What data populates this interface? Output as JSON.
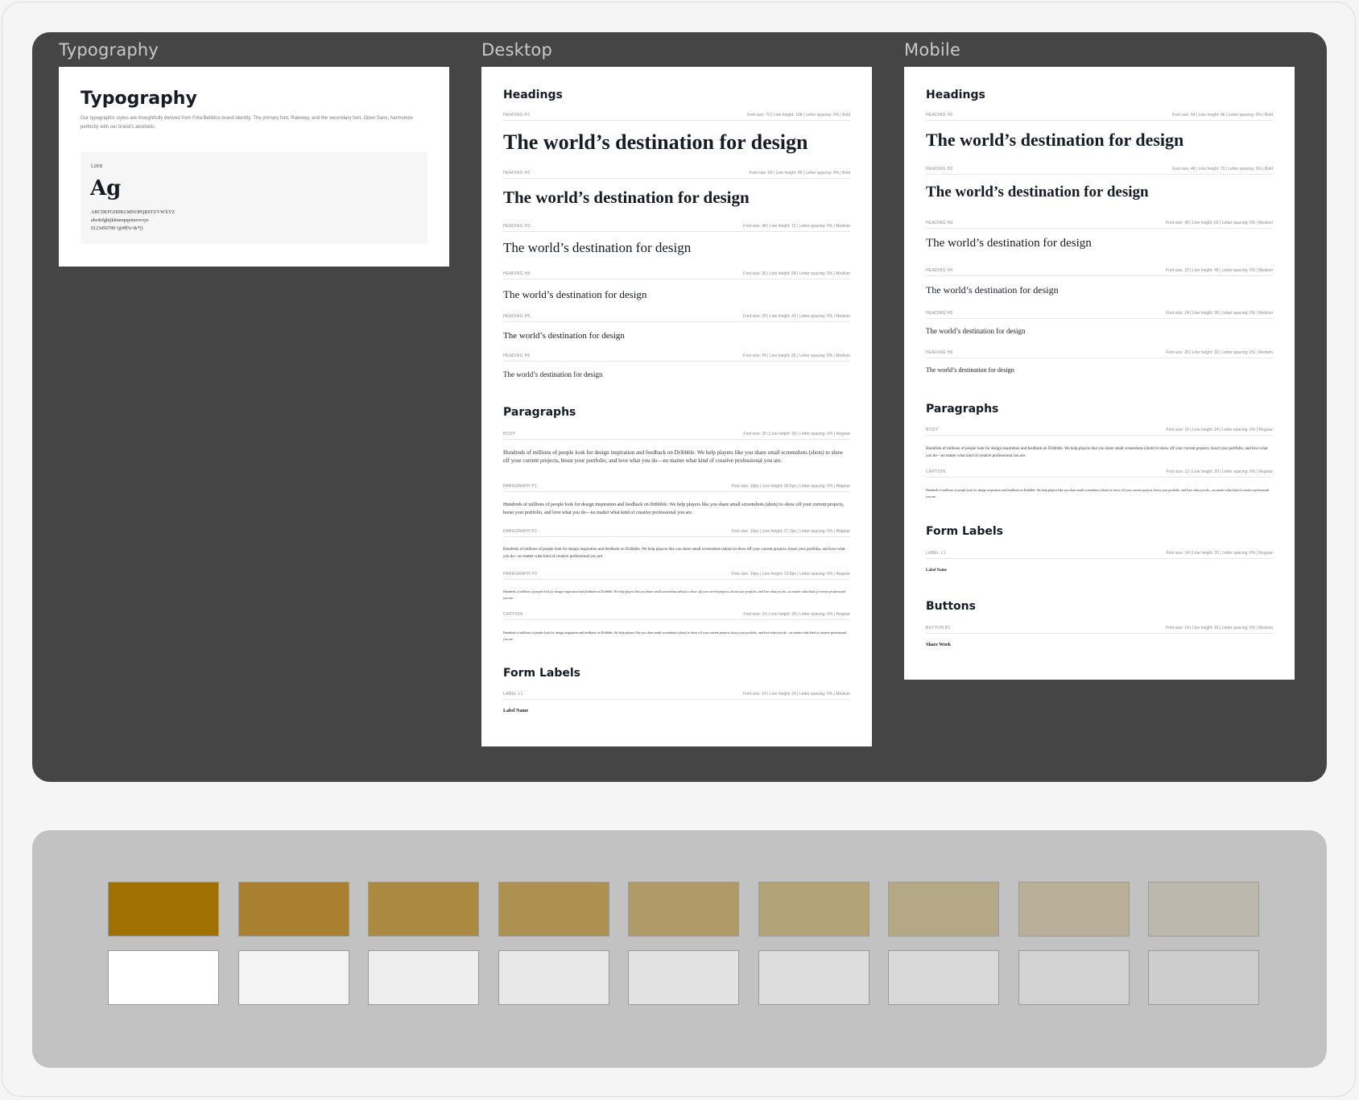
{
  "frames": {
    "typography_label": "Typography",
    "desktop_label": "Desktop",
    "mobile_label": "Mobile"
  },
  "typography_card": {
    "title": "Typography",
    "description": "Our typographic styles are thoughtfully derived from Frita Bellidos brand identity. The primary font, Raleway, and the secondary font, Open Sans, harmonize perfectly with our brand's aesthetic.",
    "font_name": "Lora",
    "specimen": "Ag",
    "uppercase": "ABCDEFGHIJKLMNOPQRSTUVWXYZ",
    "lowercase": "abcdefghijklmnopqrstuvwxyz",
    "numerals": "0123456789 !@#$%^&*()"
  },
  "sample_text": "The world’s destination for design",
  "paragraph_text": "Hundreds of millions of people look for design inspiration and feedback on Dribbble. We help players like you share small screenshots (shots) to show off your current projects, boost your portfolio, and love what you do—no matter what kind of creative professional you are.",
  "label_sample": "Label Name",
  "button_sample": "Share Work",
  "sections": {
    "headings": "Headings",
    "paragraphs": "Paragraphs",
    "form_labels": "Form Labels",
    "buttons": "Buttons"
  },
  "desktop": {
    "headings": [
      {
        "name": "HEADING H1",
        "meta": "Font size: 72 | Line height: 108 | Letter spacing: 0% | Bold"
      },
      {
        "name": "HEADING H2",
        "meta": "Font size: 60 | Line height: 90 | Letter spacing: 0% | Bold"
      },
      {
        "name": "HEADING H3",
        "meta": "Font size: 48 | Line height: 72 | Letter spacing: 0% | Medium"
      },
      {
        "name": "HEADING H4",
        "meta": "Font size: 36 | Line height: 54 | Letter spacing: 0% | Medium"
      },
      {
        "name": "HEADING H5",
        "meta": "Font size: 28 | Line height: 42 | Letter spacing: 0% | Medium"
      },
      {
        "name": "HEADING H6",
        "meta": "Font size: 24 | Line height: 36 | Letter spacing: 0% | Medium"
      }
    ],
    "paragraphs": [
      {
        "name": "BODY",
        "meta": "Font size: 20 | Line height: 30 | Letter spacing: 0% | Regular"
      },
      {
        "name": "PARAGRAPH P1",
        "meta": "Font size: 18px | Line height: 30.6px | Letter spacing: 0% | Regular"
      },
      {
        "name": "PARAGRAPH P2",
        "meta": "Font size: 16px | Line height: 27.2px | Letter spacing: 0% | Regular"
      },
      {
        "name": "PARAGRAPH P3",
        "meta": "Font size: 14px | Line height: 23.8px | Letter spacing: 0% | Regular"
      },
      {
        "name": "CAPTION",
        "meta": "Font size: 14 | Line height: 25 | Letter spacing: 0% | Regular"
      }
    ],
    "form_labels": [
      {
        "name": "LABEL L1",
        "meta": "Font size: 14 | Line height: 20 | Letter spacing: 0% | Medium"
      }
    ]
  },
  "mobile": {
    "headings": [
      {
        "name": "HEADING H1",
        "meta": "Font size: 64 | Line height: 96 | Letter spacing: 0% | Bold"
      },
      {
        "name": "HEADING H2",
        "meta": "Font size: 48 | Line height: 72 | Letter spacing: 0% | Bold"
      },
      {
        "name": "HEADING H3",
        "meta": "Font size: 40 | Line height: 60 | Letter spacing: 0% | Medium"
      },
      {
        "name": "HEADING H4",
        "meta": "Font size: 32 | Line height: 48 | Letter spacing: 0% | Medium"
      },
      {
        "name": "HEADING H5",
        "meta": "Font size: 24 | Line height: 36 | Letter spacing: 0% | Medium"
      },
      {
        "name": "HEADING H6",
        "meta": "Font size: 20 | Line height: 32 | Letter spacing: 0% | Medium"
      }
    ],
    "paragraphs": [
      {
        "name": "BODY",
        "meta": "Font size: 16 | Line height: 24 | Letter spacing: 0% | Regular"
      },
      {
        "name": "CAPTION",
        "meta": "Font size: 12 | Line height: 20 | Letter spacing: 0% | Regular"
      }
    ],
    "form_labels": [
      {
        "name": "LABEL L1",
        "meta": "Font size: 14 | Line height: 20 | Letter spacing: 0% | Regular"
      }
    ],
    "buttons": [
      {
        "name": "BUTTON B1",
        "meta": "Font size: 14 | Line height: 16 | Letter spacing: 0% | Medium"
      }
    ]
  },
  "palette": {
    "gold": [
      "#a07000",
      "#a98030",
      "#aa8a40",
      "#ad9150",
      "#b09a68",
      "#b3a278",
      "#b5a884",
      "#bab09a",
      "#bdb8ac"
    ],
    "neutral": [
      "#ffffff",
      "#f3f3f3",
      "#eeeeee",
      "#e8e8e8",
      "#e2e2e2",
      "#dddddd",
      "#d8d8d8",
      "#d2d2d2",
      "#cdcdcd"
    ]
  }
}
